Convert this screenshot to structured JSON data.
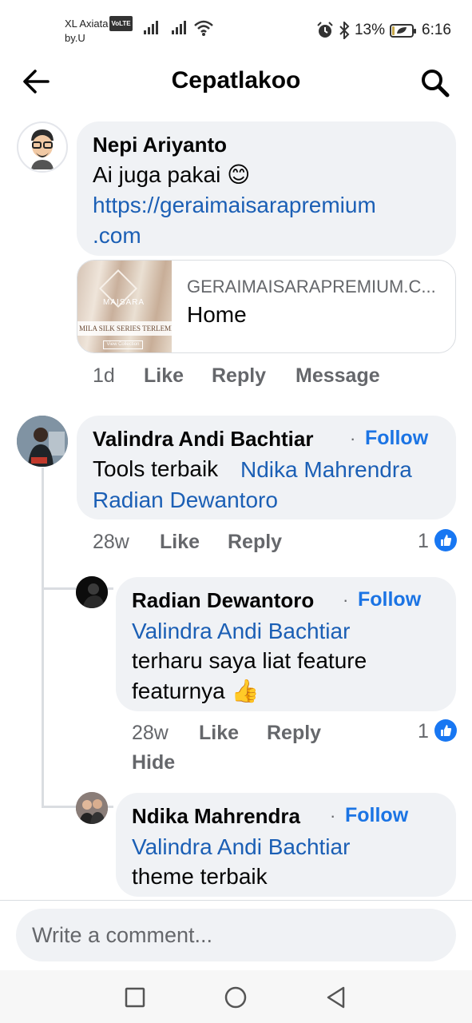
{
  "status_bar": {
    "carrier": "XL Axiata",
    "volte": "VoLTE",
    "carrier_sub": "by.U",
    "battery_percent": "13%",
    "battery_level": 0.13,
    "time": "6:16"
  },
  "header": {
    "title": "Cepatlakoo"
  },
  "comments": [
    {
      "author": "Nepi Ariyanto",
      "text_line1": "Ai juga pakai",
      "emoji": "😊",
      "link_line1": "https://geraimaisarapremium",
      "link_line2": ".com",
      "preview": {
        "domain": "GERAIMAISARAPREMIUM.C...",
        "title": "Home",
        "thumb_brand": "MAISARA",
        "thumb_strip": "MILA SILK SERIES TERLEMBUT",
        "thumb_button": "View Collection"
      },
      "time": "1d",
      "like": "Like",
      "reply": "Reply",
      "message": "Message"
    },
    {
      "author": "Valindra Andi Bachtiar",
      "follow": "Follow",
      "text": "Tools terbaik",
      "mention1": "Ndika Mahrendra",
      "mention2": "Radian Dewantoro",
      "time": "28w",
      "like": "Like",
      "reply": "Reply",
      "reactions": "1"
    }
  ],
  "replies": [
    {
      "author": "Radian Dewantoro",
      "follow": "Follow",
      "mention": "Valindra Andi Bachtiar",
      "text_line1": "terharu saya liat feature",
      "text_line2": "featurnya",
      "emoji": "👍",
      "time": "28w",
      "like": "Like",
      "reply": "Reply",
      "hide": "Hide",
      "reactions": "1"
    },
    {
      "author": "Ndika Mahrendra",
      "follow": "Follow",
      "mention": "Valindra Andi Bachtiar",
      "text": "theme terbaik"
    }
  ],
  "composer": {
    "placeholder": "Write a comment..."
  },
  "icons": [
    "back-arrow-icon",
    "search-icon",
    "alarm-icon",
    "bluetooth-icon",
    "wifi-icon",
    "signal-icon",
    "battery-icon",
    "like-reaction-icon",
    "square-nav-icon",
    "circle-nav-icon",
    "triangle-nav-icon"
  ],
  "colors": {
    "accent": "#1b74e4",
    "link": "#1b5fb5",
    "bubble": "#f0f2f5",
    "muted": "#65676b"
  }
}
